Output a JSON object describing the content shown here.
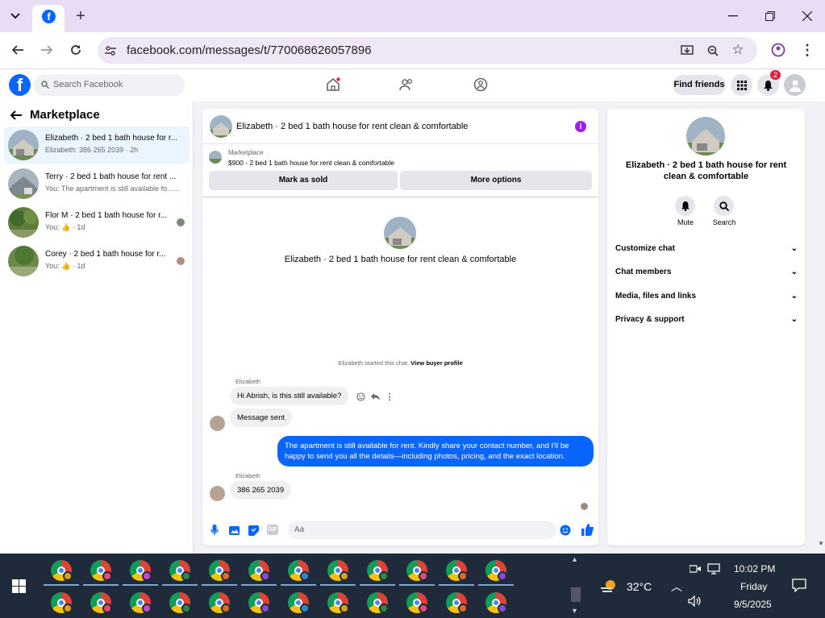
{
  "browser": {
    "url": "facebook.com/messages/t/770068626057896",
    "window_controls": [
      "minimize",
      "maximize",
      "close"
    ]
  },
  "fb_nav": {
    "search_placeholder": "Search Facebook",
    "find_friends": "Find friends",
    "notification_count": "2"
  },
  "sidebar": {
    "title": "Marketplace",
    "conversations": [
      {
        "title": "Elizabeth · 2 bed 1 bath house for r...",
        "subtitle": "Elizabeth: 386 265 2039 · 2h"
      },
      {
        "title": "Terry · 2 bed 1 bath house for rent ...",
        "subtitle": "You: The apartment is still available fo... · 2h"
      },
      {
        "title": "Flor M · 2 bed 1 bath house for r...",
        "subtitle": "You: 👍 · 1d"
      },
      {
        "title": "Corey · 2 bed 1 bath house for r...",
        "subtitle": "You: 👍 · 1d"
      }
    ]
  },
  "chat": {
    "header_title": "Elizabeth · 2 bed 1 bath house for rent clean & comfortable",
    "marketplace_label": "Marketplace",
    "listing": "$900 - 2 bed 1 bath house for rent clean & comfortable",
    "mark_as_sold": "Mark as sold",
    "more_options": "More options",
    "intro_title": "Elizabeth · 2 bed 1 bath house for rent clean & comfortable",
    "started_text": "Elizabeth started this chat.",
    "view_buyer_profile": "View buyer profile",
    "sender_name_1": "Elizabeth",
    "msg_1": "Hi Abrish, is this still available?",
    "msg_2": "Message sent",
    "msg_out": "The apartment is still available for rent. Kindly share your contact number, and I'll be happy to send you all the details—including photos, pricing, and the exact location.",
    "sender_name_2": "Elizabeth",
    "msg_3": "386 265 2039",
    "composer_placeholder": "Aa"
  },
  "info_panel": {
    "name": "Elizabeth · 2 bed 1 bath house for rent clean & comfortable",
    "mute": "Mute",
    "search": "Search",
    "sections": [
      "Customize chat",
      "Chat members",
      "Media, files and links",
      "Privacy & support"
    ]
  },
  "taskbar": {
    "temperature": "32°C",
    "time": "10:02 PM",
    "day": "Friday",
    "date": "9/5/2025"
  },
  "colors": {
    "fb_blue": "#0866ff",
    "taskbar": "#1f2b3a",
    "chrome_frame": "#e9dcf5"
  }
}
